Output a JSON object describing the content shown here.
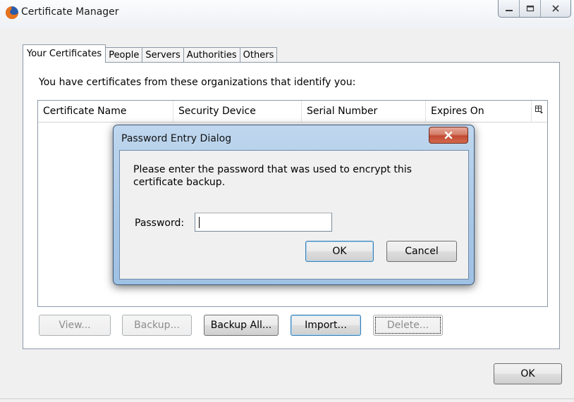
{
  "window": {
    "title": "Certificate Manager",
    "app_icon": "firefox-icon",
    "controls": [
      "minimize-icon",
      "maximize-icon",
      "close-icon"
    ]
  },
  "tabs": [
    {
      "label": "Your Certificates",
      "active": true
    },
    {
      "label": "People",
      "active": false
    },
    {
      "label": "Servers",
      "active": false
    },
    {
      "label": "Authorities",
      "active": false
    },
    {
      "label": "Others",
      "active": false
    }
  ],
  "panel": {
    "caption": "You have certificates from these organizations that identify you:",
    "columns": [
      "Certificate Name",
      "Security Device",
      "Serial Number",
      "Expires On"
    ],
    "column_picker_icon": "column-picker-icon"
  },
  "actions": {
    "view": "View...",
    "backup": "Backup...",
    "backup_all": "Backup All...",
    "import": "Import...",
    "delete": "Delete..."
  },
  "footer": {
    "ok": "OK"
  },
  "dialog": {
    "title": "Password Entry Dialog",
    "message": "Please enter the password that was used to encrypt this certificate backup.",
    "password_label": "Password:",
    "password_value": "",
    "ok": "OK",
    "cancel": "Cancel"
  },
  "colors": {
    "dialog_frame": "#a8c7e6",
    "close_button": "#c14a33",
    "window_bg": "#f0f0f0"
  }
}
